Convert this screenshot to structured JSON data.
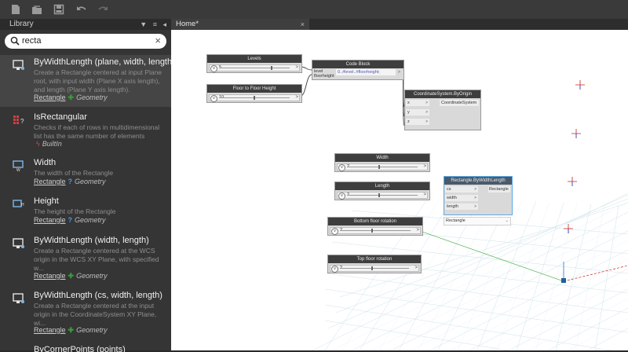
{
  "toolbar": {
    "icons": [
      "new-file-icon",
      "open-icon",
      "save-icon",
      "undo-icon",
      "redo-icon"
    ]
  },
  "library": {
    "header_title": "Library",
    "search_value": "recta",
    "items": [
      {
        "title": "ByWidthLength (plane, width, length)",
        "desc": "Create a Rectangle centered at input Plane root, with input width (Plane X axis length), and length (Plane Y axis length).",
        "category": "Rectangle",
        "group": "Geometry",
        "icon": "rectangle-plane-icon",
        "selected": true
      },
      {
        "title": "IsRectangular",
        "desc": "Checks if each of rows in multidimensional list has the same number of elements",
        "category": "",
        "group": "BuiltIn",
        "icon": "grid-question-icon",
        "selected": false
      },
      {
        "title": "Width",
        "desc": "The width of the Rectangle",
        "category": "Rectangle",
        "group": "Geometry",
        "icon": "rectangle-width-icon",
        "selected": false
      },
      {
        "title": "Height",
        "desc": "The height of the Rectangle",
        "category": "Rectangle",
        "group": "Geometry",
        "icon": "rectangle-height-icon",
        "selected": false
      },
      {
        "title": "ByWidthLength (width, length)",
        "desc": "Create a Rectangle centered at the WCS origin in the WCS XY Plane, with specified w...",
        "category": "Rectangle",
        "group": "Geometry",
        "icon": "rectangle-plane-icon",
        "selected": false
      },
      {
        "title": "ByWidthLength (cs, width, length)",
        "desc": "Create a Rectangle centered at the input origin in the CoordinateSystem XY Plane, wi...",
        "category": "Rectangle",
        "group": "Geometry",
        "icon": "rectangle-plane-icon",
        "selected": false
      },
      {
        "title": "ByCornerPoints (points)",
        "desc": "",
        "category": "",
        "group": "",
        "icon": "rectangle-plane-icon",
        "selected": false
      }
    ]
  },
  "workspace": {
    "tab_label": "Home*"
  },
  "nodes": {
    "levels": {
      "title": "Levels",
      "value": "5"
    },
    "floor_height": {
      "title": "Floor to Floor Height",
      "value": "10"
    },
    "code_block": {
      "title": "Code Block",
      "in1": "level",
      "in2": "floorheight",
      "code": "0..#level..#floorheight;"
    },
    "coord": {
      "title": "CoordinateSystem.ByOrigin",
      "in1": "x",
      "in2": "y",
      "in3": "z",
      "out": "CoordinateSystem"
    },
    "width": {
      "title": "Width",
      "value": "?"
    },
    "length": {
      "title": "Length",
      "value": "?"
    },
    "rect": {
      "title": "Rectangle.ByWidthLength",
      "in1": "cs",
      "in2": "width",
      "in3": "length",
      "out": "Rectangle",
      "preview": "Rectangle"
    },
    "bottom_rot": {
      "title": "Bottom floor rotation",
      "value": "?"
    },
    "top_rot": {
      "title": "Top floor rotation",
      "value": "?"
    }
  },
  "colors": {
    "accent_green": "#3a9a3a",
    "accent_blue": "#4a9adf",
    "builtin_red": "#e04040"
  }
}
